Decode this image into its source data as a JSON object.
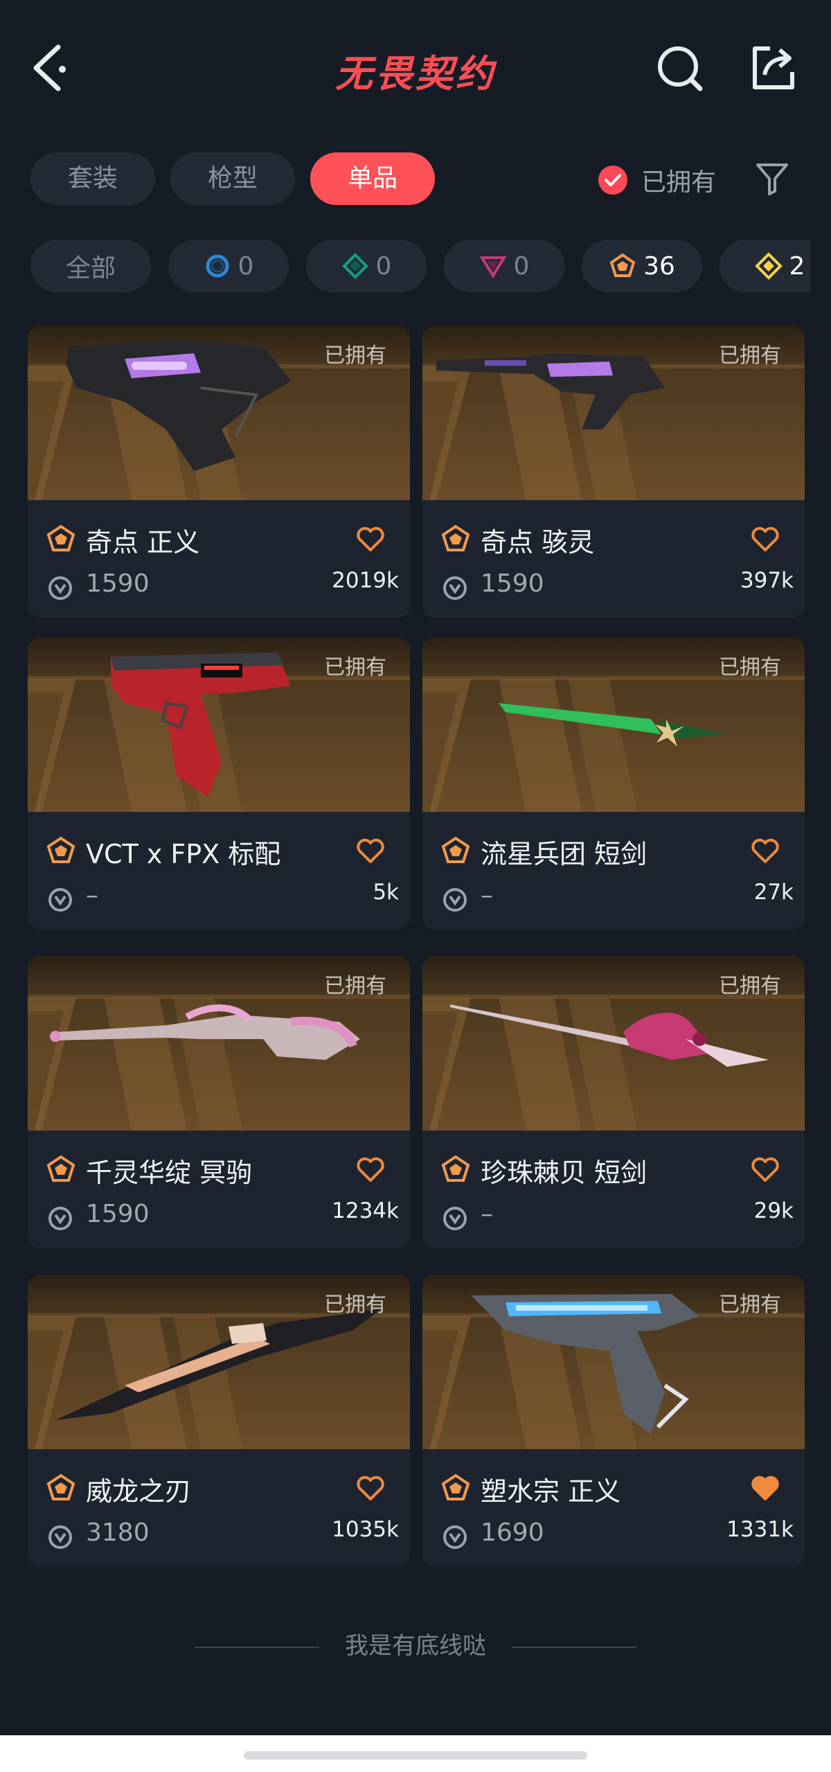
{
  "header": {
    "title": "无畏契约",
    "back_icon": "chevron-left-icon",
    "search_icon": "search-icon",
    "share_icon": "share-icon"
  },
  "category_tabs": [
    {
      "label": "套装",
      "active": false
    },
    {
      "label": "枪型",
      "active": false
    },
    {
      "label": "单品",
      "active": true
    }
  ],
  "owned_filter": {
    "label": "已拥有",
    "checked": true
  },
  "rarity_chips": [
    {
      "label": "全部"
    },
    {
      "tier": "select",
      "count": "0",
      "color": "#3a9ae6"
    },
    {
      "tier": "deluxe",
      "count": "0",
      "color": "#1fb59a"
    },
    {
      "tier": "premium",
      "count": "0",
      "color": "#d6468c"
    },
    {
      "tier": "exclusive",
      "count": "36",
      "color": "#f39a4d"
    },
    {
      "tier": "ultra",
      "count": "2",
      "color": "#f7d34a"
    }
  ],
  "items": [
    {
      "owned": "已拥有",
      "name": "奇点 正义",
      "price": "1590",
      "likes": "2019k",
      "liked": false
    },
    {
      "owned": "已拥有",
      "name": "奇点 骇灵",
      "price": "1590",
      "likes": "397k",
      "liked": false
    },
    {
      "owned": "已拥有",
      "name": "VCT x FPX 标配",
      "price": "–",
      "likes": "5k",
      "liked": false
    },
    {
      "owned": "已拥有",
      "name": "流星兵团 短剑",
      "price": "–",
      "likes": "27k",
      "liked": false
    },
    {
      "owned": "已拥有",
      "name": "千灵华绽 冥驹",
      "price": "1590",
      "likes": "1234k",
      "liked": false
    },
    {
      "owned": "已拥有",
      "name": "珍珠棘贝 短剑",
      "price": "–",
      "likes": "29k",
      "liked": false
    },
    {
      "owned": "已拥有",
      "name": "威龙之刃",
      "price": "3180",
      "likes": "1035k",
      "liked": false
    },
    {
      "owned": "已拥有",
      "name": "塑水宗 正义",
      "price": "1690",
      "likes": "1331k",
      "liked": true
    }
  ],
  "footer": {
    "text": "我是有底线哒"
  },
  "colors": {
    "accent": "#ff5258",
    "heart": "#f08a3c",
    "tier_orange": "#f39a4d"
  }
}
